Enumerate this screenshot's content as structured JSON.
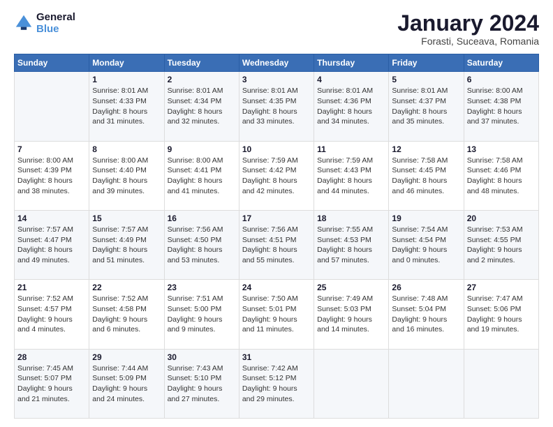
{
  "logo": {
    "line1": "General",
    "line2": "Blue"
  },
  "title": "January 2024",
  "subtitle": "Forasti, Suceava, Romania",
  "weekdays": [
    "Sunday",
    "Monday",
    "Tuesday",
    "Wednesday",
    "Thursday",
    "Friday",
    "Saturday"
  ],
  "weeks": [
    [
      {
        "day": null,
        "sunrise": null,
        "sunset": null,
        "daylight": null
      },
      {
        "day": "1",
        "sunrise": "Sunrise: 8:01 AM",
        "sunset": "Sunset: 4:33 PM",
        "daylight": "Daylight: 8 hours and 31 minutes."
      },
      {
        "day": "2",
        "sunrise": "Sunrise: 8:01 AM",
        "sunset": "Sunset: 4:34 PM",
        "daylight": "Daylight: 8 hours and 32 minutes."
      },
      {
        "day": "3",
        "sunrise": "Sunrise: 8:01 AM",
        "sunset": "Sunset: 4:35 PM",
        "daylight": "Daylight: 8 hours and 33 minutes."
      },
      {
        "day": "4",
        "sunrise": "Sunrise: 8:01 AM",
        "sunset": "Sunset: 4:36 PM",
        "daylight": "Daylight: 8 hours and 34 minutes."
      },
      {
        "day": "5",
        "sunrise": "Sunrise: 8:01 AM",
        "sunset": "Sunset: 4:37 PM",
        "daylight": "Daylight: 8 hours and 35 minutes."
      },
      {
        "day": "6",
        "sunrise": "Sunrise: 8:00 AM",
        "sunset": "Sunset: 4:38 PM",
        "daylight": "Daylight: 8 hours and 37 minutes."
      }
    ],
    [
      {
        "day": "7",
        "sunrise": "Sunrise: 8:00 AM",
        "sunset": "Sunset: 4:39 PM",
        "daylight": "Daylight: 8 hours and 38 minutes."
      },
      {
        "day": "8",
        "sunrise": "Sunrise: 8:00 AM",
        "sunset": "Sunset: 4:40 PM",
        "daylight": "Daylight: 8 hours and 39 minutes."
      },
      {
        "day": "9",
        "sunrise": "Sunrise: 8:00 AM",
        "sunset": "Sunset: 4:41 PM",
        "daylight": "Daylight: 8 hours and 41 minutes."
      },
      {
        "day": "10",
        "sunrise": "Sunrise: 7:59 AM",
        "sunset": "Sunset: 4:42 PM",
        "daylight": "Daylight: 8 hours and 42 minutes."
      },
      {
        "day": "11",
        "sunrise": "Sunrise: 7:59 AM",
        "sunset": "Sunset: 4:43 PM",
        "daylight": "Daylight: 8 hours and 44 minutes."
      },
      {
        "day": "12",
        "sunrise": "Sunrise: 7:58 AM",
        "sunset": "Sunset: 4:45 PM",
        "daylight": "Daylight: 8 hours and 46 minutes."
      },
      {
        "day": "13",
        "sunrise": "Sunrise: 7:58 AM",
        "sunset": "Sunset: 4:46 PM",
        "daylight": "Daylight: 8 hours and 48 minutes."
      }
    ],
    [
      {
        "day": "14",
        "sunrise": "Sunrise: 7:57 AM",
        "sunset": "Sunset: 4:47 PM",
        "daylight": "Daylight: 8 hours and 49 minutes."
      },
      {
        "day": "15",
        "sunrise": "Sunrise: 7:57 AM",
        "sunset": "Sunset: 4:49 PM",
        "daylight": "Daylight: 8 hours and 51 minutes."
      },
      {
        "day": "16",
        "sunrise": "Sunrise: 7:56 AM",
        "sunset": "Sunset: 4:50 PM",
        "daylight": "Daylight: 8 hours and 53 minutes."
      },
      {
        "day": "17",
        "sunrise": "Sunrise: 7:56 AM",
        "sunset": "Sunset: 4:51 PM",
        "daylight": "Daylight: 8 hours and 55 minutes."
      },
      {
        "day": "18",
        "sunrise": "Sunrise: 7:55 AM",
        "sunset": "Sunset: 4:53 PM",
        "daylight": "Daylight: 8 hours and 57 minutes."
      },
      {
        "day": "19",
        "sunrise": "Sunrise: 7:54 AM",
        "sunset": "Sunset: 4:54 PM",
        "daylight": "Daylight: 9 hours and 0 minutes."
      },
      {
        "day": "20",
        "sunrise": "Sunrise: 7:53 AM",
        "sunset": "Sunset: 4:55 PM",
        "daylight": "Daylight: 9 hours and 2 minutes."
      }
    ],
    [
      {
        "day": "21",
        "sunrise": "Sunrise: 7:52 AM",
        "sunset": "Sunset: 4:57 PM",
        "daylight": "Daylight: 9 hours and 4 minutes."
      },
      {
        "day": "22",
        "sunrise": "Sunrise: 7:52 AM",
        "sunset": "Sunset: 4:58 PM",
        "daylight": "Daylight: 9 hours and 6 minutes."
      },
      {
        "day": "23",
        "sunrise": "Sunrise: 7:51 AM",
        "sunset": "Sunset: 5:00 PM",
        "daylight": "Daylight: 9 hours and 9 minutes."
      },
      {
        "day": "24",
        "sunrise": "Sunrise: 7:50 AM",
        "sunset": "Sunset: 5:01 PM",
        "daylight": "Daylight: 9 hours and 11 minutes."
      },
      {
        "day": "25",
        "sunrise": "Sunrise: 7:49 AM",
        "sunset": "Sunset: 5:03 PM",
        "daylight": "Daylight: 9 hours and 14 minutes."
      },
      {
        "day": "26",
        "sunrise": "Sunrise: 7:48 AM",
        "sunset": "Sunset: 5:04 PM",
        "daylight": "Daylight: 9 hours and 16 minutes."
      },
      {
        "day": "27",
        "sunrise": "Sunrise: 7:47 AM",
        "sunset": "Sunset: 5:06 PM",
        "daylight": "Daylight: 9 hours and 19 minutes."
      }
    ],
    [
      {
        "day": "28",
        "sunrise": "Sunrise: 7:45 AM",
        "sunset": "Sunset: 5:07 PM",
        "daylight": "Daylight: 9 hours and 21 minutes."
      },
      {
        "day": "29",
        "sunrise": "Sunrise: 7:44 AM",
        "sunset": "Sunset: 5:09 PM",
        "daylight": "Daylight: 9 hours and 24 minutes."
      },
      {
        "day": "30",
        "sunrise": "Sunrise: 7:43 AM",
        "sunset": "Sunset: 5:10 PM",
        "daylight": "Daylight: 9 hours and 27 minutes."
      },
      {
        "day": "31",
        "sunrise": "Sunrise: 7:42 AM",
        "sunset": "Sunset: 5:12 PM",
        "daylight": "Daylight: 9 hours and 29 minutes."
      },
      {
        "day": null,
        "sunrise": null,
        "sunset": null,
        "daylight": null
      },
      {
        "day": null,
        "sunrise": null,
        "sunset": null,
        "daylight": null
      },
      {
        "day": null,
        "sunrise": null,
        "sunset": null,
        "daylight": null
      }
    ]
  ]
}
